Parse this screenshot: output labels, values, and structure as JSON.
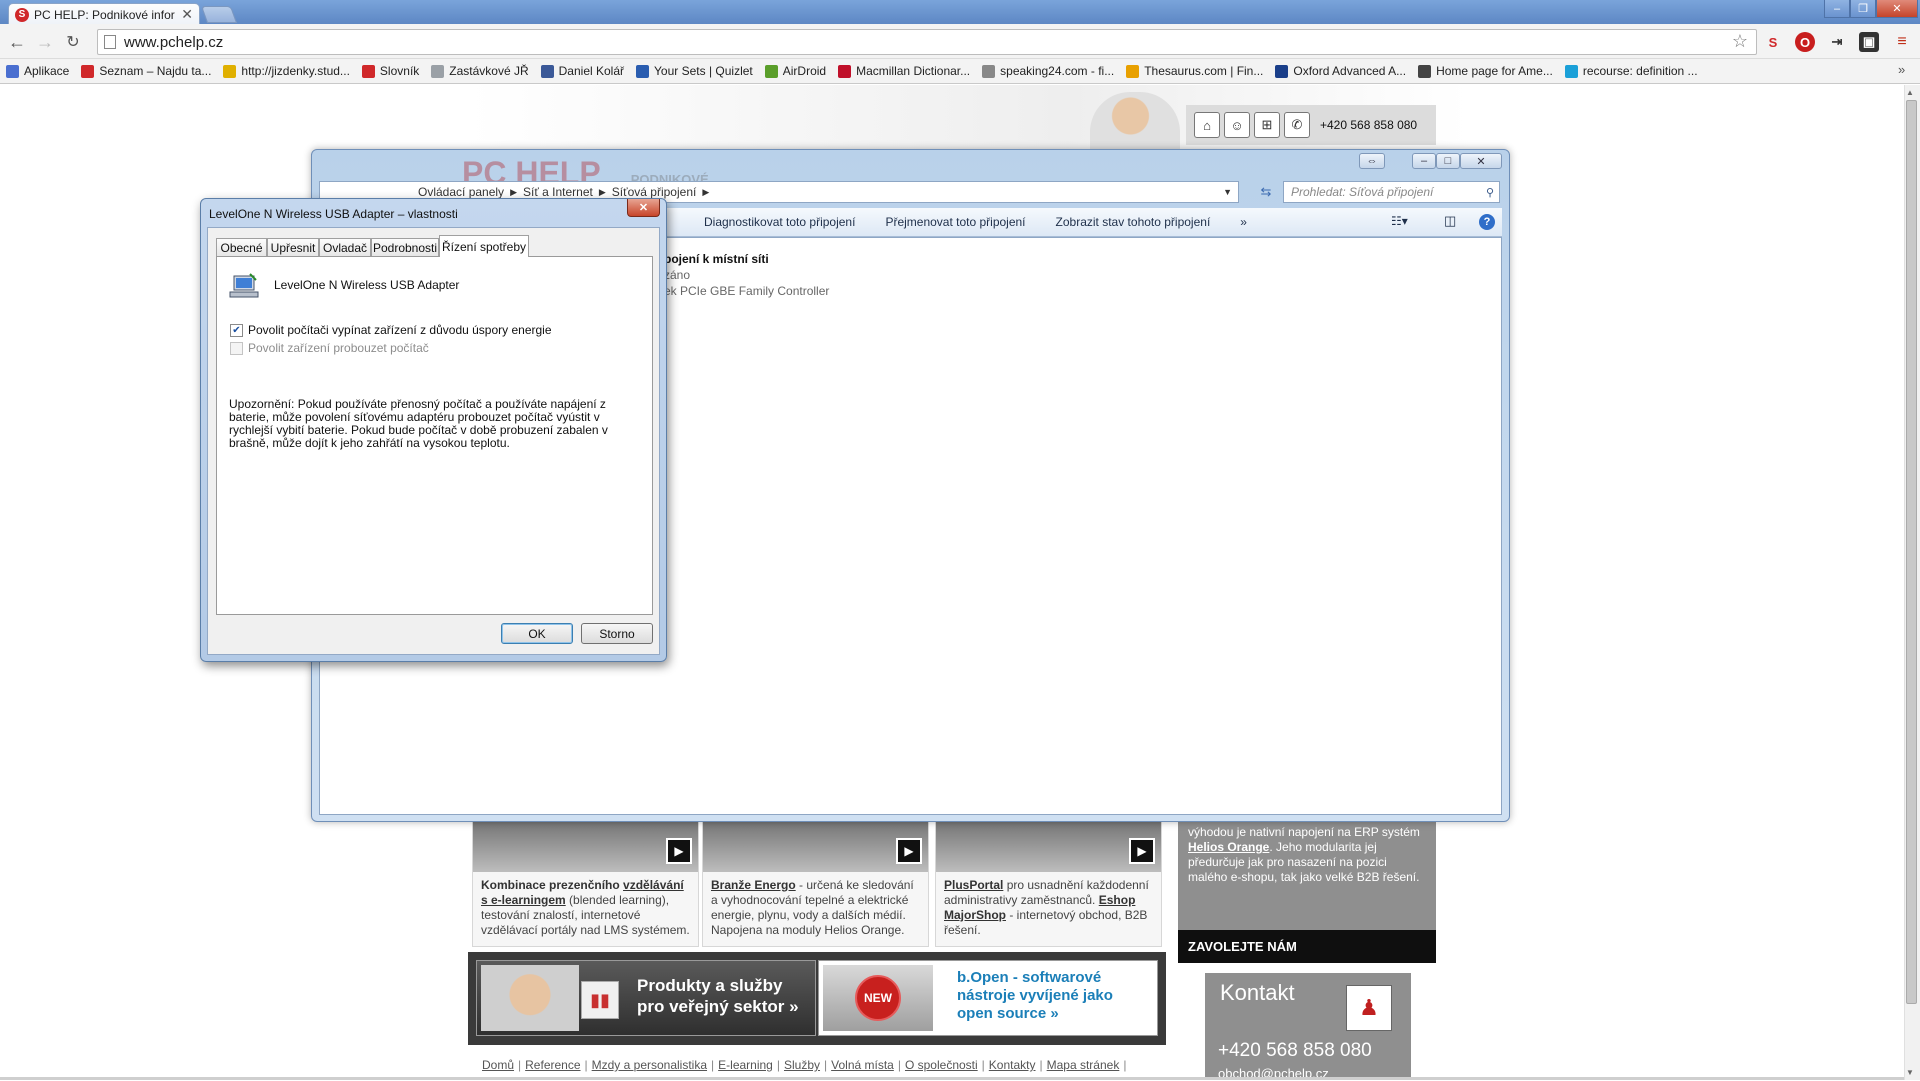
{
  "browser": {
    "tab_title": "PC HELP: Podnikové infor",
    "url": "www.pchelp.cz",
    "bookmarks": [
      {
        "label": "Aplikace",
        "icon": "apps-grid-icon",
        "color": "#4a6fd0"
      },
      {
        "label": "Seznam – Najdu ta...",
        "icon": "seznam-icon",
        "color": "#d0282a"
      },
      {
        "label": "http://jizdenky.stud...",
        "icon": "studentagency-icon",
        "color": "#e0b000"
      },
      {
        "label": "Slovník",
        "icon": "seznam-icon",
        "color": "#d0282a"
      },
      {
        "label": "Zastávkové JŘ",
        "icon": "page-icon",
        "color": "#9aa0a6"
      },
      {
        "label": "Daniel Kolář",
        "icon": "facebook-icon",
        "color": "#3b5998"
      },
      {
        "label": "Your Sets | Quizlet",
        "icon": "quizlet-icon",
        "color": "#2a5db0"
      },
      {
        "label": "AirDroid",
        "icon": "airdroid-icon",
        "color": "#5a9e2a"
      },
      {
        "label": "Macmillan Dictionar...",
        "icon": "macmillan-icon",
        "color": "#c0102a"
      },
      {
        "label": "speaking24.com - fi...",
        "icon": "headphones-icon",
        "color": "#888888"
      },
      {
        "label": "Thesaurus.com | Fin...",
        "icon": "thesaurus-icon",
        "color": "#e8a000"
      },
      {
        "label": "Oxford Advanced A...",
        "icon": "oxford-icon",
        "color": "#1a3f8a"
      },
      {
        "label": "Home page for Ame...",
        "icon": "cambridge-icon",
        "color": "#444444"
      },
      {
        "label": "recourse: definition ...",
        "icon": "dictionary-icon",
        "color": "#1aa0d8"
      }
    ],
    "more_bookmarks": "»"
  },
  "site": {
    "phone_top": "+420 568 858 080",
    "cards": [
      {
        "bold": "Kombinace prezenčního ",
        "link": "vzdělávání s e-learningem",
        "rest": " (blended learning), testování znalostí, internetové vzdělávací portály nad LMS systémem."
      },
      {
        "bold": "",
        "link": "Branže Energo",
        "rest": " - určená ke sledování a vyhodnocování tepelné a elektrické energie, plynu, vody a dalších médií. Napojena na moduly Helios Orange."
      },
      {
        "bold": "",
        "link": "PlusPortal",
        "rest": " pro usnadnění každodenní administrativy zaměstnanců. ",
        "link2": "Eshop MajorShop",
        "rest2": " - internetový obchod, B2B řešení."
      }
    ],
    "sidebar_text_pre": "výhodou je nativní napojení na ERP systém ",
    "sidebar_link": "Helios Orange",
    "sidebar_text_post": ". Jeho modularita jej předurčuje jak pro nasazení na pozici malého e-shopu, tak jako velké B2B řešení.",
    "zavolejte": "ZAVOLEJTE NÁM",
    "kontakt_title": "Kontakt",
    "kontakt_phone": "+420 568 858 080",
    "kontakt_email": "obchod@pchelp.cz",
    "promo1": [
      "Produkty a služby",
      "pro veřejný sektor »"
    ],
    "promo2": [
      "b.Open - softwarové",
      "nástroje vyvíjené jako",
      "open source »"
    ],
    "promo2_badge": "NEW",
    "footer_links": [
      "Domů",
      "Reference",
      "Mzdy a personalistika",
      "E-learning",
      "Služby",
      "Volná místa",
      "O společnosti",
      "Kontakty",
      "Mapa stránek"
    ]
  },
  "explorer": {
    "breadcrumb": [
      "Ovládací panely",
      "Síť a Internet",
      "Síťová připojení"
    ],
    "search_placeholder": "Prohledat: Síťová připojení",
    "commands": [
      "Diagnostikovat toto připojení",
      "Přejmenovat toto připojení",
      "Zobrazit stav tohoto připojení",
      "»"
    ],
    "item_title": "pojení k místní síti",
    "item_sub1": "záno",
    "item_sub2": "ek PCIe GBE Family Controller"
  },
  "dialog": {
    "title": "LevelOne N Wireless USB Adapter – vlastnosti",
    "tabs": [
      "Obecné",
      "Upřesnit",
      "Ovladač",
      "Podrobnosti",
      "Řízení spotřeby"
    ],
    "active_tab": "Řízení spotřeby",
    "device_name": "LevelOne N Wireless USB Adapter",
    "checkbox1": {
      "label": "Povolit počítači vypínat zařízení z důvodu úspory energie",
      "checked": true
    },
    "checkbox2": {
      "label": "Povolit zařízení probouzet počítač",
      "checked": false,
      "disabled": true
    },
    "note": "Upozornění: Pokud používáte přenosný počítač a používáte napájení z baterie, může povolení síťovému adaptéru probouzet počítač vyústit v rychlejší vybití baterie. Pokud bude počítač v době probuzení zabalen v brašně, může dojít k jeho zahřátí na vysokou teplotu.",
    "ok": "OK",
    "cancel": "Storno"
  }
}
